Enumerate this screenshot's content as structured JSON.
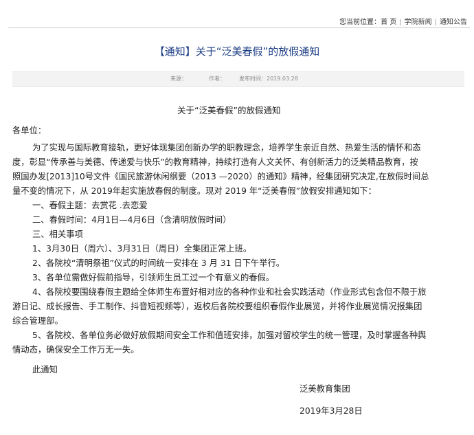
{
  "breadcrumb": {
    "prefix": "您当前位置：",
    "items": [
      "首 页",
      "学院新闻",
      "通知公告"
    ],
    "separator": "|"
  },
  "article": {
    "title": "【通知】关于“泛美春假”的放假通知",
    "meta": {
      "source_label": "来源：",
      "author_label": "作者：",
      "date_label": "发布时间：2019.03.28"
    },
    "subtitle": "关于“泛美春假”的放假通知",
    "greeting": "各单位：",
    "lines": [
      "为了实现与国际教育接轨，更好体现集团创新办学的职教理念，培养学生亲近自然、热爱生活的情怀和态",
      "度，彰显“传承善与美德、传递爱与快乐”的教育精神，持续打造有人文关怀、有创新活力的泛美精品教育，按",
      "照国办发[2013]10号文件《国民旅游休闲纲要（2013 —2020）的通知》精神，经集团研究决定,在放假时间总",
      "量不变的情况下，从 2019年起实施放春假的制度。现对 2019 年“泛美春假”放假安排通知如下：",
      "一、春假主题：去赏花 .去恋爱",
      "二、春假时间：4月1日—4月6日（含清明放假时间）",
      "三、相关事项",
      "1、3月30日（周六）、3月31日（周日）全集团正常上班。",
      "2、各院校“清明祭祖”仪式的时间统一安排在 3 月 31 日下午举行。",
      "3、各单位需做好假前指导，引领师生员工过一个有意义的春假。",
      "4、各院校要围绕春假主题给全体师生布置好相对应的各种作业和社会实践活动（作业形式包含但不限于旅",
      "游日记、成长报告、手工制作、抖音短视频等），返校后各院校要组织春假作业展览，并将作业展览情况报集团",
      "综合管理部。",
      "5、各院校、各单位务必做好放假期间安全工作和值班安排，加强对留校学生的统一管理，及时掌握各种舆",
      "情动态，确保安全工作万无一失。",
      "此通知"
    ],
    "signature": "泛美教育集团",
    "date": "2019年3月28日"
  }
}
